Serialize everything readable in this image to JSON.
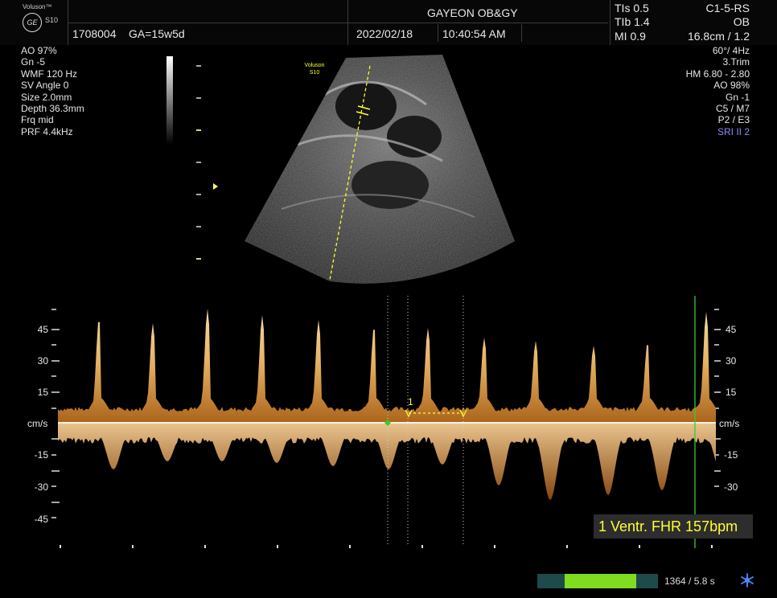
{
  "header": {
    "brand_line1": "Voluson™",
    "brand_line2": "S10",
    "logo": "GE",
    "patient_id": "1708004",
    "ga": "GA=15w5d",
    "clinic": "GAYEON OB&GY",
    "date": "2022/02/18",
    "time": "10:40:54 AM",
    "tis": "TIs  0.5",
    "tib": "TIb  1.4",
    "mi": "MI  0.9",
    "probe": "C1-5-RS",
    "app": "OB",
    "depth_zoom": "16.8cm / 1.2"
  },
  "left_params": [
    "AO 97%",
    "Gn  -5",
    "WMF 120 Hz",
    "SV Angle  0",
    "Size  2.0mm",
    "Depth 36.3mm",
    "Frq mid",
    "PRF  4.4kHz"
  ],
  "right_params": [
    "60°/  4Hz",
    "3.Trim",
    "HM  6.80 - 2.80",
    "AO 98%",
    "Gn  -1",
    "C5 / M7",
    "P2 / E3"
  ],
  "right_params_special": "SRI II 2",
  "image_overlay": {
    "brand_line1": "Voluson",
    "brand_line2": "S10"
  },
  "doppler_scale": {
    "left_labels": [
      "45",
      "30",
      "15",
      "-15",
      "-30",
      "-45"
    ],
    "right_labels": [
      "45",
      "30",
      "15",
      "-15",
      "-30"
    ],
    "unit": "cm/s"
  },
  "caliper_marker": "1",
  "measurement": "1 Ventr. FHR 157bpm",
  "progress": {
    "fraction": 0.77,
    "label": "1364 / 5.8 s"
  },
  "colors": {
    "waveform": "#f4c27a",
    "caliper": "#ffff33",
    "progress_fill": "#7fdc1e",
    "cursor_line": "#2fd02f",
    "sri": "#8c8cff"
  },
  "icons": [
    "ge-logo-icon",
    "snowflake-icon",
    "depth-marker-icon"
  ]
}
